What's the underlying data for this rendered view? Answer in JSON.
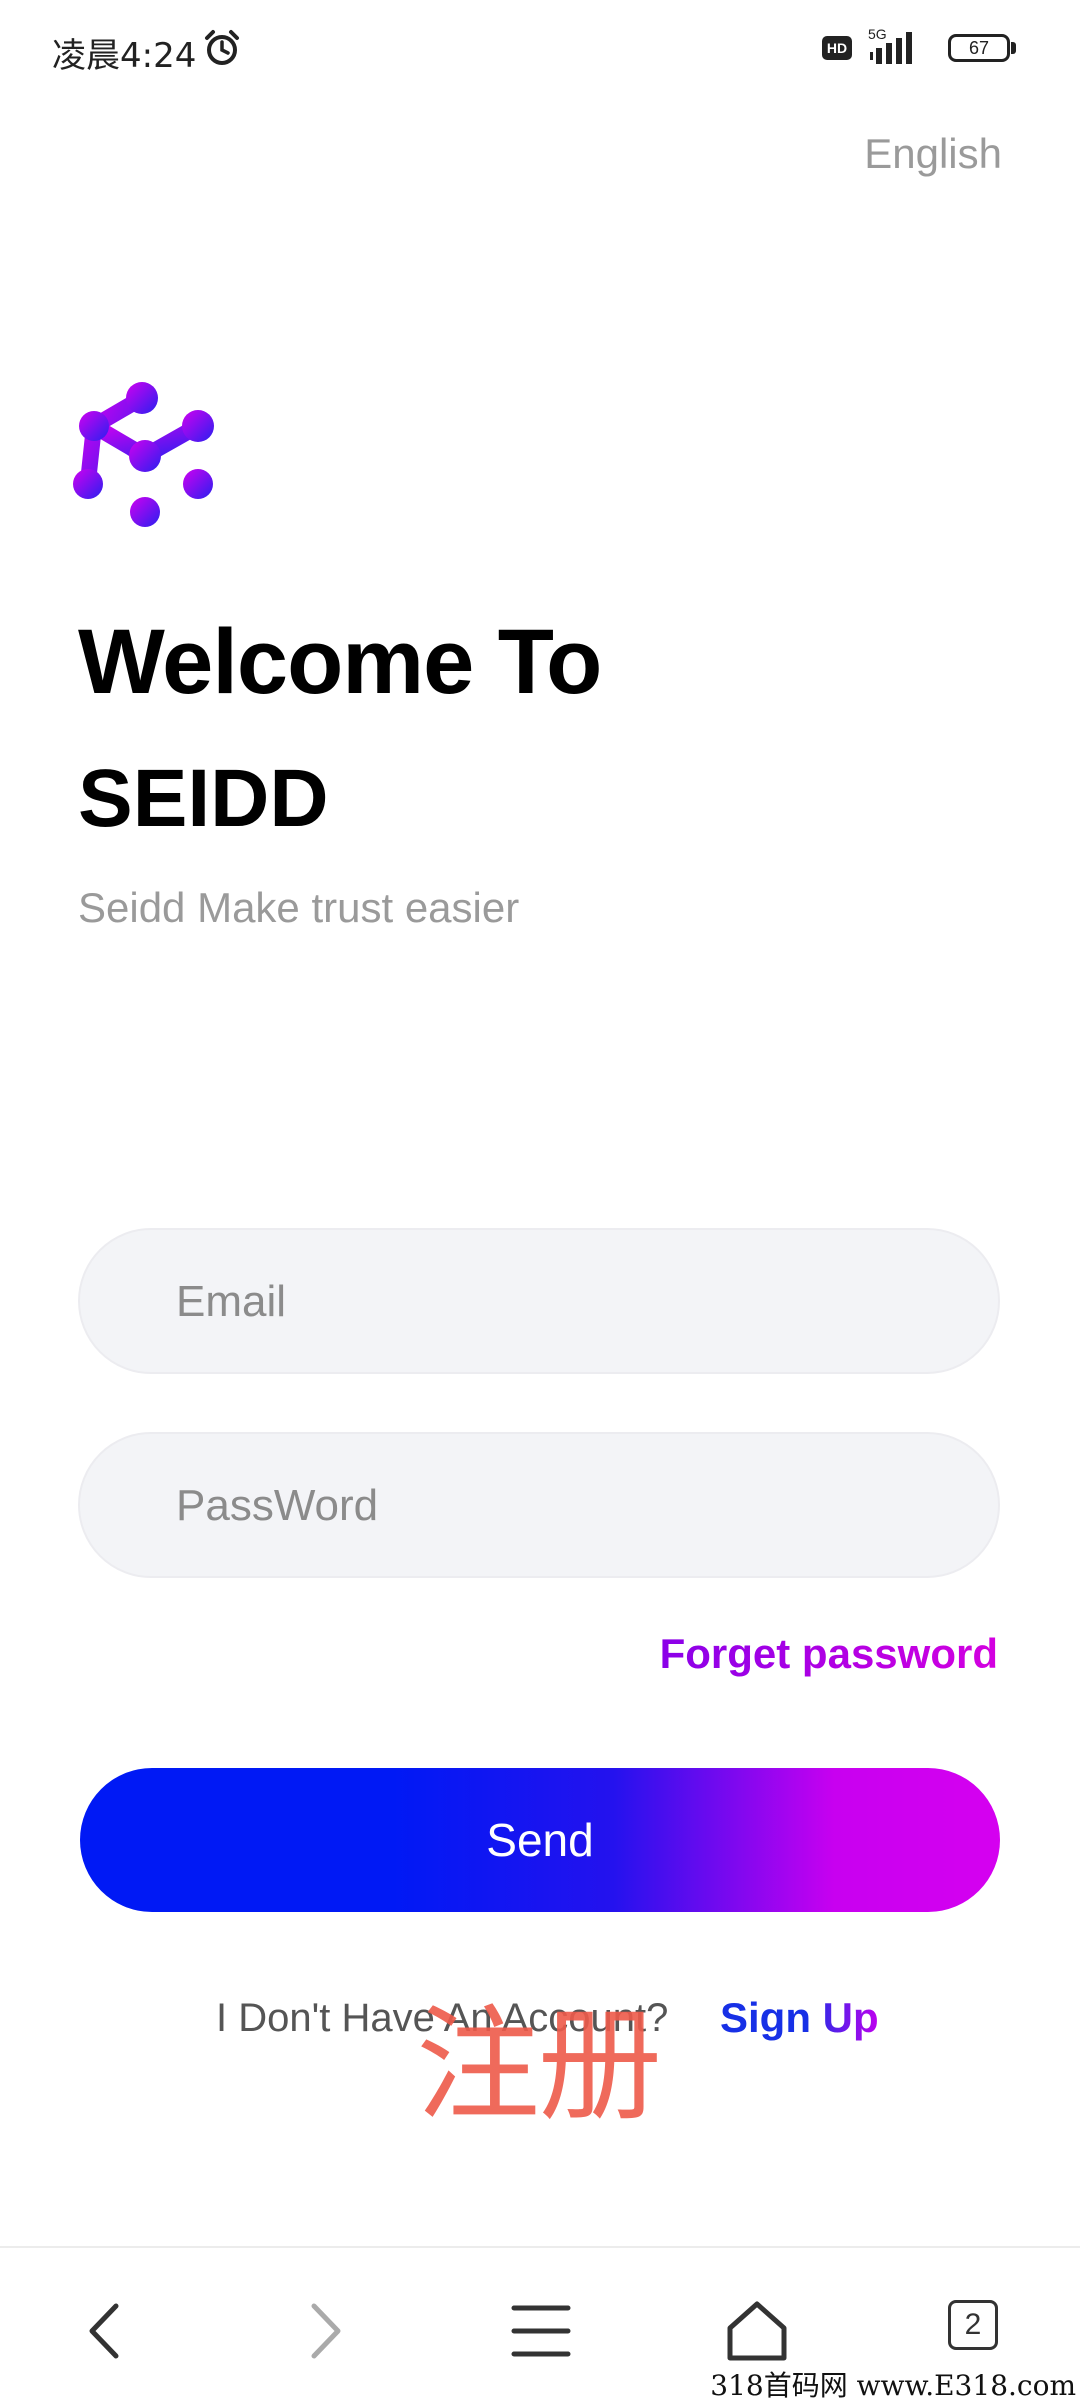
{
  "status_bar": {
    "time": "凌晨4:24",
    "hd": "HD",
    "network": "5G",
    "battery": "67"
  },
  "header": {
    "language": "English"
  },
  "welcome": {
    "title_line1": "Welcome To",
    "title_line2": "SEIDD",
    "subtitle": "Seidd Make trust easier"
  },
  "form": {
    "email_placeholder": "Email",
    "password_placeholder": "PassWord",
    "forget_label": "Forget password",
    "send_label": "Send"
  },
  "signup_row": {
    "prompt": "I Don't Have An Account?",
    "signup_label": "Sign Up",
    "overlay_text": "注册"
  },
  "bottom_nav": {
    "tab_count": "2"
  },
  "watermark": "318首码网 www.E318.com",
  "colors": {
    "accent_blue": "#0019f5",
    "accent_magenta": "#d500f0",
    "logo_purple": "#8a00e8",
    "overlay_red": "#ee5a4a"
  }
}
